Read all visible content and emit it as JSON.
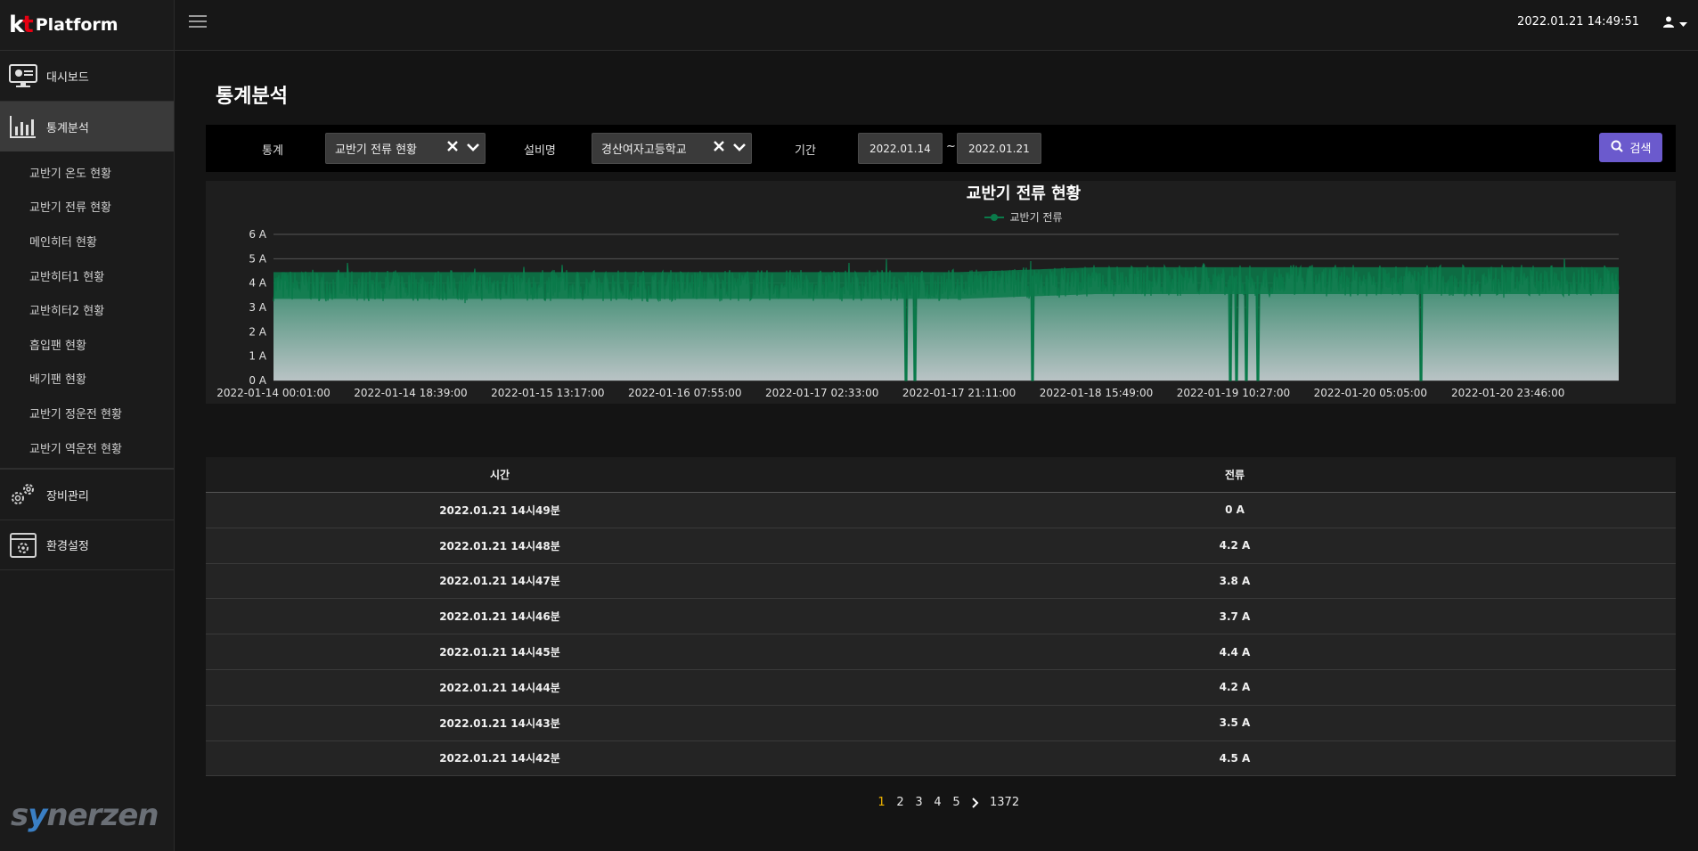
{
  "brand": {
    "logo": "kt",
    "name": "Platform"
  },
  "sidebar": {
    "menu": [
      {
        "label": "대시보드",
        "icon": "monitor-icon"
      },
      {
        "label": "통계분석",
        "icon": "bar-chart-icon"
      }
    ],
    "submenu": [
      "교반기 온도 현황",
      "교반기 전류 현황",
      "메인히터 현황",
      "교반히터1 현황",
      "교반히터2 현황",
      "흡입팬 현황",
      "배기팬 현황",
      "교반기 정운전 현황",
      "교반기 역운전 현황"
    ],
    "bottom_menu": [
      {
        "label": "장비관리",
        "icon": "gears-icon"
      },
      {
        "label": "환경설정",
        "icon": "settings-window-icon"
      }
    ],
    "footer_logo": "synerzen"
  },
  "topbar": {
    "datetime": "2022.01.21 14:49:51"
  },
  "page": {
    "title": "통계분석"
  },
  "filters": {
    "stat_label": "통계",
    "stat_value": "교반기 전류 현황",
    "facility_label": "설비명",
    "facility_value": "경산여자고등학교",
    "period_label": "기간",
    "date_from": "2022.01.14",
    "tilde": "~",
    "date_to": "2022.01.21",
    "search_label": "검색"
  },
  "chart_data": {
    "type": "area",
    "title": "교반기 전류 현황",
    "series": [
      {
        "name": "교반기 전류",
        "color": "#0a7a4a"
      }
    ],
    "ylim": [
      0,
      6
    ],
    "y_ticks": [
      "6 A",
      "5 A",
      "4 A",
      "3 A",
      "2 A",
      "1 A",
      "0 A"
    ],
    "x_ticks": [
      "2022-01-14 00:01:00",
      "2022-01-14 18:39:00",
      "2022-01-15 13:17:00",
      "2022-01-16 07:55:00",
      "2022-01-17 02:33:00",
      "2022-01-17 21:11:00",
      "2022-01-18 15:49:00",
      "2022-01-19 10:27:00",
      "2022-01-20 05:05:00",
      "2022-01-20 23:46:00"
    ],
    "typical_range": [
      3.0,
      4.9
    ],
    "baseline_trend": [
      {
        "x": "2022-01-14 00:01:00",
        "y": 3.9
      },
      {
        "x": "2022-01-17 21:11:00",
        "y": 3.9
      },
      {
        "x": "2022-01-18 15:49:00",
        "y": 4.1
      },
      {
        "x": "2022-01-20 23:46:00",
        "y": 4.1
      }
    ],
    "zero_dips": [
      "2022-01-17 13:55:00",
      "2022-01-17 15:10:00",
      "2022-01-18 07:10:00",
      "2022-01-19 10:00:00",
      "2022-01-19 10:50:00",
      "2022-01-19 12:15:00",
      "2022-01-19 13:45:00",
      "2022-01-20 12:00:00"
    ],
    "grid": true,
    "legend": "top-center"
  },
  "table": {
    "headers": [
      "시간",
      "전류"
    ],
    "rows": [
      [
        "2022.01.21 14시49분",
        "0 A"
      ],
      [
        "2022.01.21 14시48분",
        "4.2 A"
      ],
      [
        "2022.01.21 14시47분",
        "3.8 A"
      ],
      [
        "2022.01.21 14시46분",
        "3.7 A"
      ],
      [
        "2022.01.21 14시45분",
        "4.4 A"
      ],
      [
        "2022.01.21 14시44분",
        "4.2 A"
      ],
      [
        "2022.01.21 14시43분",
        "3.5 A"
      ],
      [
        "2022.01.21 14시42분",
        "4.5 A"
      ]
    ]
  },
  "pagination": {
    "pages": [
      "1",
      "2",
      "3",
      "4",
      "5"
    ],
    "active": "1",
    "last": "1372"
  }
}
